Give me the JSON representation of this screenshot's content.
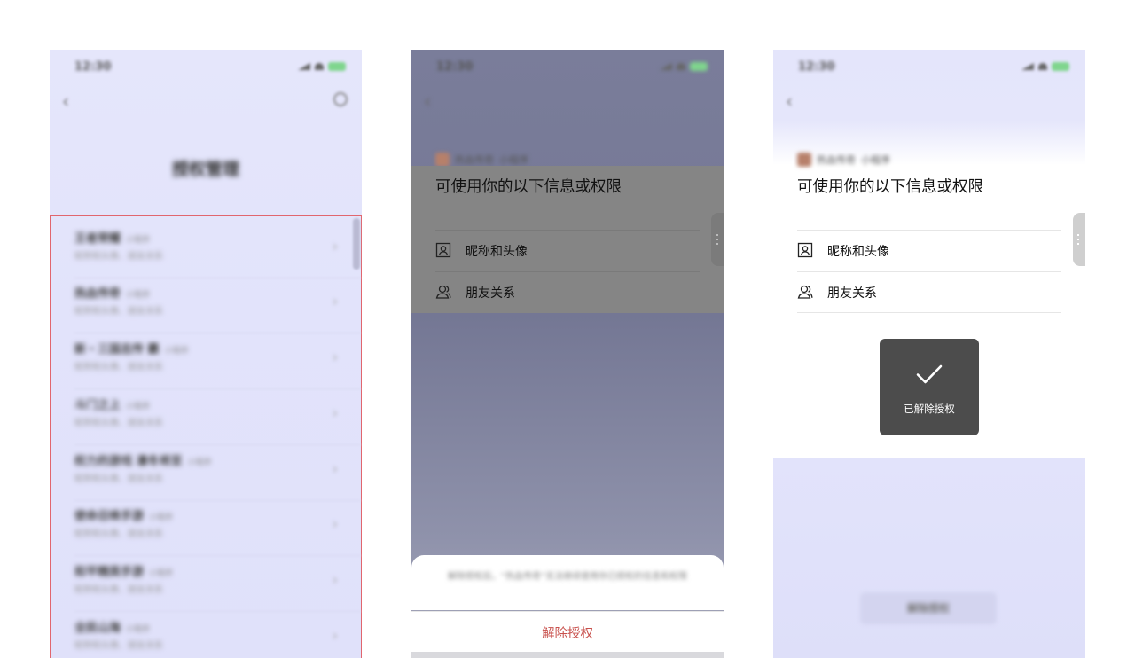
{
  "status_bar": {
    "time": "12:30"
  },
  "phone1": {
    "title": "授权管理",
    "items": [
      {
        "name": "王者荣耀",
        "tag": "小程序",
        "desc": "昵称和头像、朋友关系"
      },
      {
        "name": "热血传奇",
        "tag": "小程序",
        "desc": "昵称和头像、朋友关系"
      },
      {
        "name": "新・三国志传 霸",
        "tag": "小程序",
        "desc": "昵称和头像、朋友关系"
      },
      {
        "name": "斗门之上",
        "tag": "小程序",
        "desc": "昵称和头像、朋友关系"
      },
      {
        "name": "权力的游戏 凛冬将至",
        "tag": "小程序",
        "desc": "昵称和头像、朋友关系"
      },
      {
        "name": "使命召唤手游",
        "tag": "小程序",
        "desc": "昵称和头像、朋友关系"
      },
      {
        "name": "和平精英手游",
        "tag": "小程序",
        "desc": "昵称和头像、朋友关系"
      },
      {
        "name": "全民山海",
        "tag": "小程序",
        "desc": "昵称和头像、朋友关系"
      }
    ]
  },
  "phone2": {
    "app_name": "热血传奇",
    "app_tag": "小程序",
    "perm_title": "可使用你的以下信息或权限",
    "perms": [
      "昵称和头像",
      "朋友关系"
    ],
    "sheet_note": "解除授权后，“热血传奇”无法继续使用你已授权的信息和权限",
    "action_label": "解除授权"
  },
  "phone3": {
    "app_name": "热血传奇",
    "app_tag": "小程序",
    "perm_title": "可使用你的以下信息或权限",
    "perms": [
      "昵称和头像",
      "朋友关系"
    ],
    "toast_text": "已解除授权",
    "bottom_button": "解除授权"
  },
  "icons": {
    "back": "chevron-left-icon",
    "search": "search-icon",
    "avatar_perm": "portrait-icon",
    "friends_perm": "friends-icon",
    "toast": "checkmark-icon"
  }
}
